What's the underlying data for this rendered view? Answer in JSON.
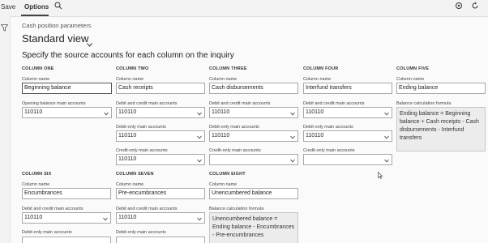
{
  "toolbar": {
    "save_label": "Save",
    "options_label": "Options",
    "search_icon": "search-icon",
    "right_icons": [
      "settings-icon",
      "refresh-icon"
    ]
  },
  "breadcrumb": "Cash position parameters",
  "view": {
    "title": "Standard view",
    "chevron": "chevron-down-icon"
  },
  "section_title": "Specify the source accounts for each column on the inquiry",
  "columns": {
    "one": {
      "header": "COLUMN ONE",
      "name_label": "Column name",
      "name_value": "Beginning balance",
      "opening_label": "Opening balance main accounts",
      "opening_value": "110110"
    },
    "two": {
      "header": "COLUMN TWO",
      "name_label": "Column name",
      "name_value": "Cash receipts",
      "debit_credit_label": "Debit and credit main accounts",
      "debit_credit_value": "110110",
      "debit_only_label": "Debit-only main accounts",
      "debit_only_value": "110110",
      "credit_only_label": "Credit-only main accounts",
      "credit_only_value": "110110"
    },
    "three": {
      "header": "COLUMN THREE",
      "name_label": "Column name",
      "name_value": "Cash disbursements",
      "debit_credit_label": "Debit and credit main accounts",
      "debit_credit_value": "110110",
      "debit_only_label": "Debit-only main accounts",
      "debit_only_value": "110110",
      "credit_only_label": "Credit-only main accounts",
      "credit_only_value": ""
    },
    "four": {
      "header": "COLUMN FOUR",
      "name_label": "Column name",
      "name_value": "Interfund transfers",
      "debit_credit_label": "Debit and credit main accounts",
      "debit_credit_value": "110110",
      "debit_only_label": "Debit-only main accounts",
      "debit_only_value": "110110",
      "credit_only_label": "Credit-only main accounts",
      "credit_only_value": ""
    },
    "five": {
      "header": "COLUMN FIVE",
      "name_label": "Column name",
      "name_value": "Ending balance",
      "formula_label": "Balance calculation formula",
      "formula_value": "Ending balance = Beginning balance + Cash receipts - Cash disbursements - Interfund transfers"
    },
    "six": {
      "header": "COLUMN SIX",
      "name_label": "Column name",
      "name_value": "Encumbrances",
      "debit_credit_label": "Debit and credit main accounts",
      "debit_credit_value": "110110",
      "debit_only_label": "Debit-only main accounts"
    },
    "seven": {
      "header": "COLUMN SEVEN",
      "name_label": "Column name",
      "name_value": "Pre-encumbrances",
      "debit_credit_label": "Debit and credit main accounts",
      "debit_credit_value": "110110",
      "debit_only_label": "Debit-only main accounts"
    },
    "eight": {
      "header": "COLUMN EIGHT",
      "name_label": "Column name",
      "name_value": "Unencumbered balance",
      "formula_label": "Balance calculation formula",
      "formula_value": "Unencumbered balance = Ending balance - Encumbrances - Pre-encumbrances"
    }
  },
  "colors": {
    "accent": "#444444",
    "field_border": "#a8a8a8",
    "formula_bg": "#ececec"
  }
}
